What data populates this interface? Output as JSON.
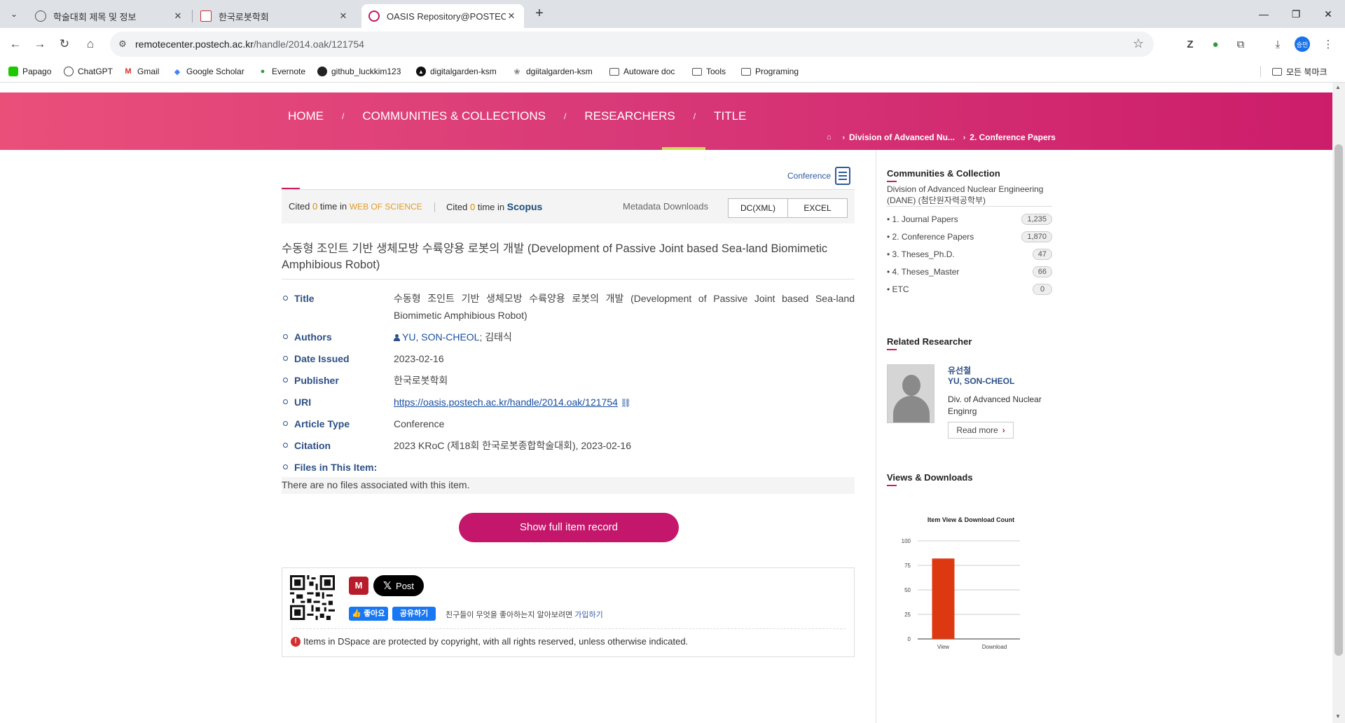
{
  "browser": {
    "tabs": [
      {
        "title": "학술대회 제목 및 정보",
        "active": false
      },
      {
        "title": "한국로봇학회",
        "active": false
      },
      {
        "title": "OASIS Repository@POSTECHL",
        "active": true
      }
    ],
    "url_host": "remotecenter.postech.ac.kr",
    "url_path": "/handle/2014.oak/121754",
    "profile_label": "승민",
    "bookmarks": [
      "Papago",
      "ChatGPT",
      "Gmail",
      "Google Scholar",
      "Evernote",
      "github_luckkim123",
      "digitalgarden-ksm",
      "dgiitalgarden-ksm",
      "Autoware doc",
      "Tools",
      "Programing"
    ],
    "all_bookmarks": "모든 북마크"
  },
  "site": {
    "nav": [
      "HOME",
      "COMMUNITIES & COLLECTIONS",
      "RESEARCHERS",
      "TITLE"
    ],
    "breadcrumbs": [
      "Division of Advanced Nu...",
      "2. Conference Papers"
    ],
    "accent": "#c4166b"
  },
  "item": {
    "type_label": "Conference",
    "cite_prefix": "Cited",
    "cite_wos_count": "0",
    "cite_mid": "time in",
    "wos_label": "WEB OF SCIENCE",
    "cite_scopus_count": "0",
    "scopus_label": "Scopus",
    "metadata_downloads": "Metadata Downloads",
    "btn_dc": "DC(XML)",
    "btn_excel": "EXCEL",
    "heading": "수동형 조인트 기반 생체모방 수륙양용 로봇의 개발 (Development of Passive Joint based Sea-land Biomimetic Amphibious Robot)",
    "fields": {
      "title_key": "Title",
      "title_val": "수동형 조인트 기반 생체모방 수륙양용 로봇의 개발 (Development of Passive Joint based Sea-land Biomimetic Amphibious Robot)",
      "authors_key": "Authors",
      "author_link": "YU, SON-CHEOL",
      "author_rest": "; 김태식",
      "date_key": "Date Issued",
      "date_val": "2023-02-16",
      "publisher_key": "Publisher",
      "publisher_val": "한국로봇학회",
      "uri_key": "URI",
      "uri_val": "https://oasis.postech.ac.kr/handle/2014.oak/121754",
      "type_key": "Article Type",
      "type_val": "Conference",
      "citation_key": "Citation",
      "citation_val": "2023 KRoC (제18회 한국로봇종합학술대회), 2023-02-16",
      "files_key": "Files in This Item:"
    },
    "no_files": "There are no files associated with this item.",
    "show_full": "Show full item record",
    "share": {
      "x_post": "Post",
      "fb_like": "좋아요",
      "fb_share": "공유하기",
      "fb_text": "친구들이 무엇을 좋아하는지 알아보려면",
      "fb_join": "가입하기"
    },
    "copyright": "Items in DSpace are protected by copyright, with all rights reserved, unless otherwise indicated."
  },
  "sidebar": {
    "collection_heading": "Communities & Collection",
    "collection_name": "Division of Advanced Nuclear Engineering (DANE) (첨단원자력공학부)",
    "collections": [
      {
        "label": "1. Journal Papers",
        "count": "1,235"
      },
      {
        "label": "2. Conference Papers",
        "count": "1,870"
      },
      {
        "label": "3. Theses_Ph.D.",
        "count": "47"
      },
      {
        "label": "4. Theses_Master",
        "count": "66"
      },
      {
        "label": "ETC",
        "count": "0"
      }
    ],
    "researcher_heading": "Related Researcher",
    "researcher_kor": "유선철",
    "researcher_eng": "YU, SON-CHEOL",
    "researcher_dept": "Div. of Advanced Nuclear Enginrg",
    "read_more": "Read more",
    "views_heading": "Views & Downloads"
  },
  "chart_data": {
    "type": "bar",
    "title": "Item View & Download Count",
    "categories": [
      "View",
      "Download"
    ],
    "values": [
      82,
      0
    ],
    "ylim": [
      0,
      100
    ],
    "yticks": [
      0,
      25,
      50,
      75,
      100
    ],
    "bar_color": "#dc3912",
    "grid": true
  }
}
